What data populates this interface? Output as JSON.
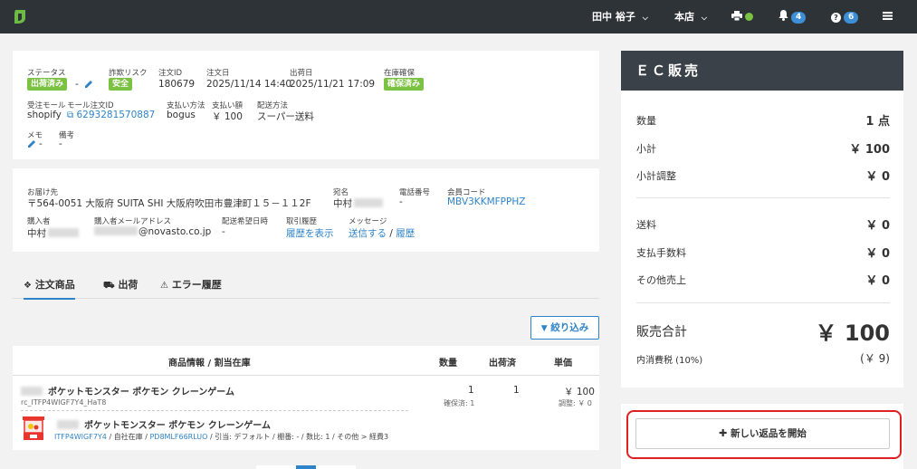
{
  "topbar": {
    "user": "田中 裕子",
    "store": "本店",
    "notifications_count": "4",
    "help_count": "6",
    "colors": {
      "bg": "#2e3338",
      "badge": "#3d8fd6",
      "status": "#7bc142"
    }
  },
  "order": {
    "status_label": "ステータス",
    "status_value": "出荷済み",
    "status_dash": "-",
    "fraud_label": "詐欺リスク",
    "fraud_value": "安全",
    "order_id_label": "注文ID",
    "order_id": "180679",
    "order_date_label": "注文日",
    "order_date": "2025/11/14 14:40",
    "ship_date_label": "出荷日",
    "ship_date": "2025/11/21 17:09",
    "stock_label": "在庫確保",
    "stock_value": "確保済み",
    "mall_label": "受注モール",
    "mall": "shopify",
    "mall_order_id_label": "モール注文ID",
    "mall_order_id": "6293281570887",
    "payment_label": "支払い方法",
    "payment": "bogus",
    "amount_label": "支払い額",
    "amount": "￥ 100",
    "delivery_label": "配送方法",
    "delivery": "スーパー送料",
    "memo_label": "メモ",
    "memo": "-",
    "note_label": "備考",
    "note": "-"
  },
  "address": {
    "dest_label": "お届け先",
    "dest": "〒564-0051 大阪府 SUITA SHI 大阪府吹田市豊津町１５－１１2F",
    "name_label": "宛名",
    "name": "中村",
    "phone_label": "電話番号",
    "phone": "-",
    "member_label": "会員コード",
    "member": "MBV3KKMFPPHZ",
    "buyer_label": "購入者",
    "buyer": "中村",
    "email_label": "購入者メールアドレス",
    "email": "@novasto.co.jp",
    "wish_label": "配送希望日時",
    "wish": "-",
    "history_label": "取引履歴",
    "history_link": "履歴を表示",
    "message_label": "メッセージ",
    "message_send": "送信する",
    "message_sep": "/",
    "message_history": "履歴"
  },
  "tabs": [
    {
      "label": "注文商品",
      "icon": "cubes-icon"
    },
    {
      "label": "出荷",
      "icon": "truck-icon"
    },
    {
      "label": "エラー履歴",
      "icon": "warning-icon"
    }
  ],
  "filter_label": "絞り込み",
  "table": {
    "headers": [
      "商品情報 / 割当在庫",
      "数量",
      "出荷済",
      "単価"
    ],
    "row": {
      "name": "ポケットモンスター ポケモン クレーンゲーム",
      "sku": "rc_ITFP4WIGF7Y4_HaT8",
      "qty": "1",
      "reserved": "確保済: 1",
      "shipped": "1",
      "price": "￥ 100",
      "adjust": "調整: ￥ 0",
      "alloc_name": "ポケットモンスター ポケモン クレーンゲーム",
      "alloc_code": "ITFP4WIGF7Y4",
      "alloc_sep1": " / 自社在庫 / ",
      "alloc_loc": "PD8MLF66RLUO",
      "alloc_rest": " / 引当: デフォルト / 棚番: - / 数比: 1 / その他 > 経費3"
    }
  },
  "ec": {
    "title": "ＥＣ販売",
    "qty_label": "数量",
    "qty": "1 点",
    "subtotal_label": "小計",
    "subtotal": "￥ 100",
    "subtotal_adj_label": "小計調整",
    "subtotal_adj": "￥ 0",
    "shipping_label": "送料",
    "shipping": "￥ 0",
    "fee_label": "支払手数料",
    "fee": "￥ 0",
    "other_label": "その他売上",
    "other": "￥ 0",
    "total_label": "販売合計",
    "total": "￥ 100",
    "tax_label": "内消費税 (10%)",
    "tax": "(￥ 9)"
  },
  "return_button": "新しい返品を開始"
}
